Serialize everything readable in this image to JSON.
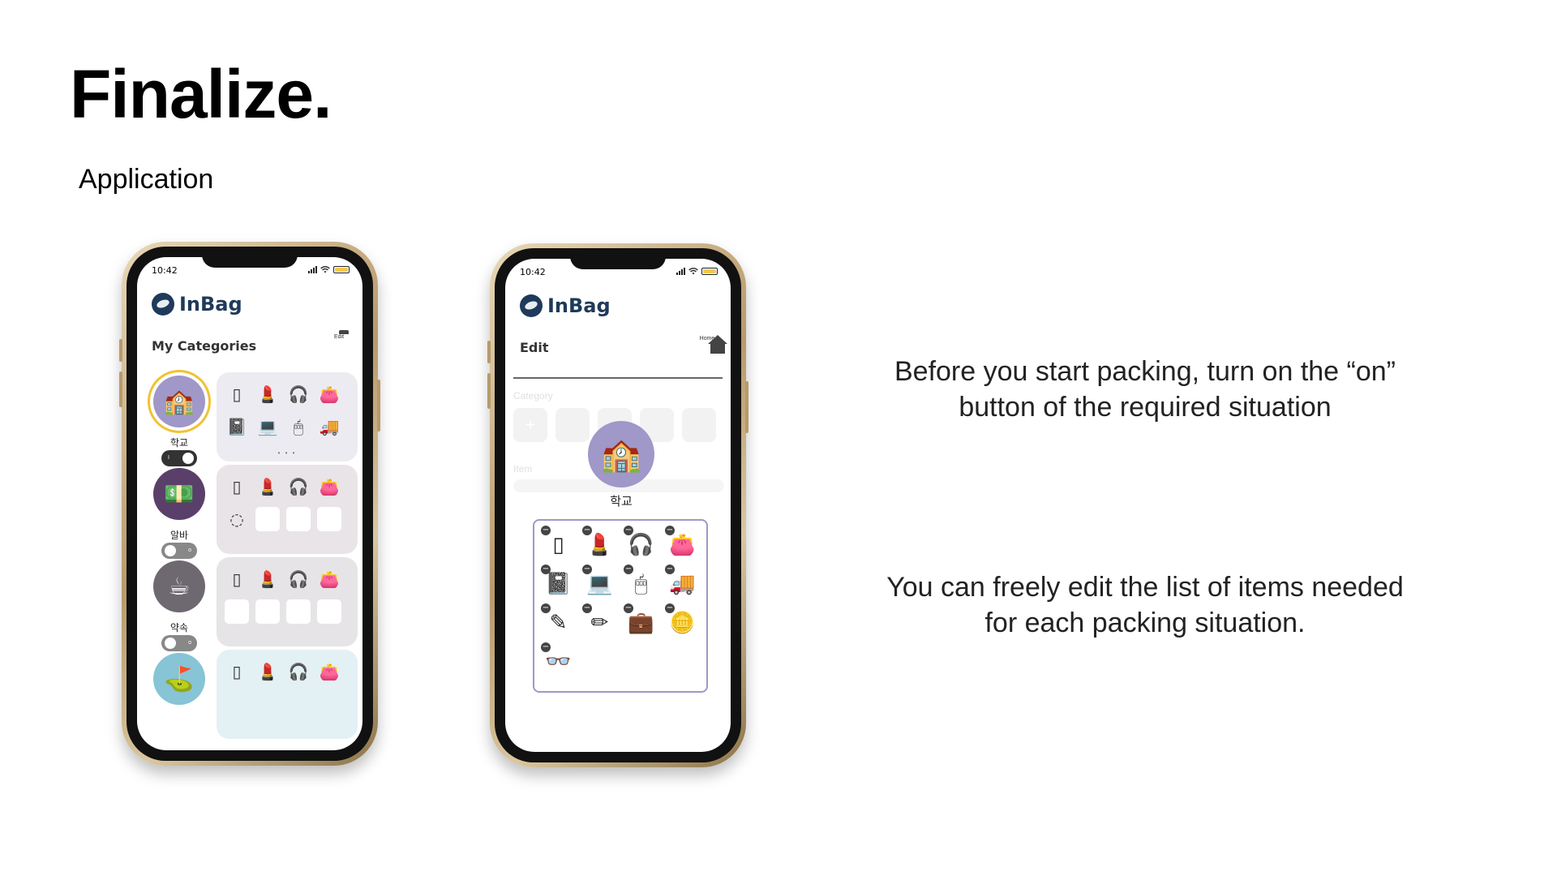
{
  "slide": {
    "title": "Finalize.",
    "section": "Application",
    "description_1": "Before you start packing, turn on the “on” button of the required situation",
    "description_2": "You can freely edit the list of items needed for each packing situation."
  },
  "phone_home": {
    "status_time": "10:42",
    "app_name": "InBag",
    "header_title": "My Categories",
    "header_button_label": "Edit",
    "categories": [
      {
        "name": "학교",
        "color": "#9f98c8",
        "toggle_on": true,
        "toggle_mark": "I",
        "icon": "🏫",
        "items": [
          "▯",
          "💄",
          "🎧",
          "👛",
          "📓",
          "💻",
          "🖱",
          "🚚"
        ],
        "pager": "• • •"
      },
      {
        "name": "알바",
        "color": "#5a3f6b",
        "toggle_on": false,
        "toggle_mark": "o",
        "icon": "💵",
        "items": [
          "▯",
          "💄",
          "🎧",
          "👛",
          "◌",
          "",
          "",
          ""
        ],
        "pager": ""
      },
      {
        "name": "약속",
        "color": "#6e6870",
        "toggle_on": false,
        "toggle_mark": "o",
        "icon": "☕",
        "items": [
          "▯",
          "💄",
          "🎧",
          "👛",
          "",
          "",
          "",
          ""
        ],
        "pager": ""
      },
      {
        "name": "",
        "color": "#86c4d6",
        "toggle_on": false,
        "toggle_mark": "",
        "icon": "⛳",
        "items": [
          "▯",
          "💄",
          "🎧",
          "👛"
        ],
        "pager": ""
      }
    ]
  },
  "phone_edit": {
    "status_time": "10:42",
    "app_name": "InBag",
    "header_title": "Edit",
    "header_button_label": "Home",
    "faded_category_label": "Category",
    "faded_item_label": "Item",
    "category_name": "학교",
    "category_icon": "🏫",
    "category_color": "#9f98c8",
    "items": [
      "▯",
      "💄",
      "🎧",
      "👛",
      "📓",
      "💻",
      "🖱",
      "🚚",
      "✎",
      "✏",
      "💼",
      "🪙",
      "👓"
    ]
  },
  "icons": {
    "signal": "signal-icon",
    "wifi": "wifi-icon",
    "battery": "battery-icon",
    "edit": "folder-icon",
    "home": "home-icon",
    "remove": "minus-circle-icon"
  }
}
